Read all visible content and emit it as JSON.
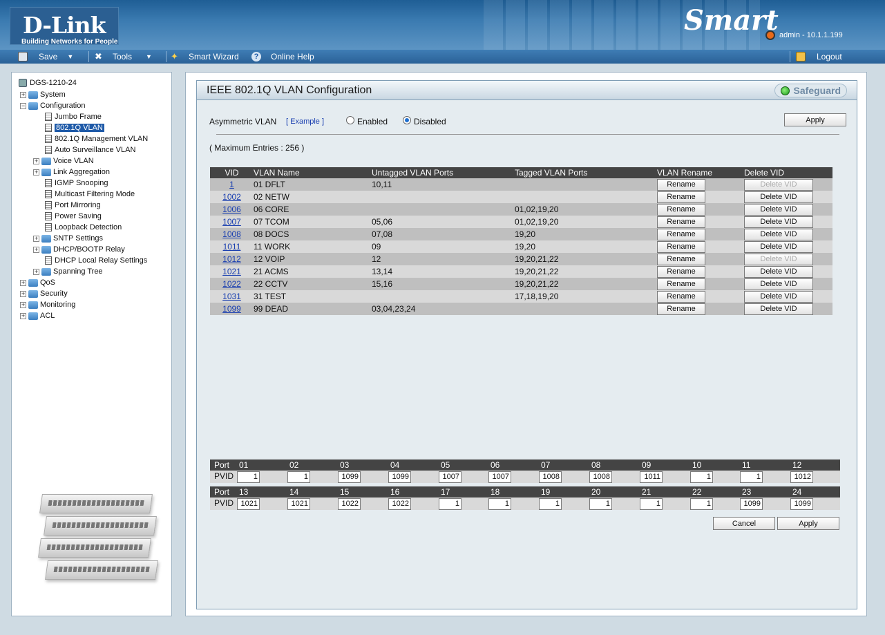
{
  "header": {
    "logo": "D-Link",
    "tagline": "Building Networks for People",
    "product": "Smart",
    "user": "admin - 10.1.1.199"
  },
  "menu": {
    "save": "Save",
    "tools": "Tools",
    "wizard": "Smart Wizard",
    "help": "Online Help",
    "logout": "Logout"
  },
  "tree": {
    "root": "DGS-1210-24",
    "system": "System",
    "configuration": "Configuration",
    "items": [
      "Jumbo Frame",
      "802.1Q VLAN",
      "802.1Q Management VLAN",
      "Auto Surveillance VLAN",
      "Voice VLAN",
      "Link Aggregation",
      "IGMP Snooping",
      "Multicast Filtering Mode",
      "Port Mirroring",
      "Power Saving",
      "Loopback Detection",
      "SNTP Settings",
      "DHCP/BOOTP Relay",
      "DHCP Local Relay Settings",
      "Spanning Tree"
    ],
    "qos": "QoS",
    "security": "Security",
    "monitoring": "Monitoring",
    "acl": "ACL"
  },
  "page": {
    "title": "IEEE 802.1Q VLAN Configuration",
    "safeguard": "Safeguard",
    "asym_label": "Asymmetric VLAN",
    "example": "[ Example ]",
    "enabled": "Enabled",
    "disabled": "Disabled",
    "apply": "Apply",
    "max_entries": "( Maximum Entries : 256 )",
    "cancel": "Cancel",
    "rename": "Rename",
    "delete": "Delete VID"
  },
  "table": {
    "headers": [
      "VID",
      "VLAN Name",
      "Untagged VLAN Ports",
      "Tagged VLAN Ports",
      "VLAN Rename",
      "Delete VID"
    ],
    "rows": [
      {
        "vid": "1",
        "name": "01 DFLT",
        "untagged": "10,11",
        "tagged": "",
        "delete_enabled": false
      },
      {
        "vid": "1002",
        "name": "02 NETW",
        "untagged": "",
        "tagged": "",
        "delete_enabled": true
      },
      {
        "vid": "1006",
        "name": "06 CORE",
        "untagged": "",
        "tagged": "01,02,19,20",
        "delete_enabled": true
      },
      {
        "vid": "1007",
        "name": "07 TCOM",
        "untagged": "05,06",
        "tagged": "01,02,19,20",
        "delete_enabled": true
      },
      {
        "vid": "1008",
        "name": "08 DOCS",
        "untagged": "07,08",
        "tagged": "19,20",
        "delete_enabled": true
      },
      {
        "vid": "1011",
        "name": "11 WORK",
        "untagged": "09",
        "tagged": "19,20",
        "delete_enabled": true
      },
      {
        "vid": "1012",
        "name": "12 VOIP",
        "untagged": "12",
        "tagged": "19,20,21,22",
        "delete_enabled": false
      },
      {
        "vid": "1021",
        "name": "21 ACMS",
        "untagged": "13,14",
        "tagged": "19,20,21,22",
        "delete_enabled": true
      },
      {
        "vid": "1022",
        "name": "22 CCTV",
        "untagged": "15,16",
        "tagged": "19,20,21,22",
        "delete_enabled": true
      },
      {
        "vid": "1031",
        "name": "31 TEST",
        "untagged": "",
        "tagged": "17,18,19,20",
        "delete_enabled": true
      },
      {
        "vid": "1099",
        "name": "99 DEAD",
        "untagged": "03,04,23,24",
        "tagged": "",
        "delete_enabled": true
      }
    ]
  },
  "pvid": {
    "port_label": "Port",
    "pvid_label": "PVID",
    "groups": [
      {
        "ports": [
          "01",
          "02",
          "03",
          "04",
          "05",
          "06",
          "07",
          "08",
          "09",
          "10",
          "11",
          "12"
        ],
        "values": [
          "1",
          "1",
          "1099",
          "1099",
          "1007",
          "1007",
          "1008",
          "1008",
          "1011",
          "1",
          "1",
          "1012"
        ]
      },
      {
        "ports": [
          "13",
          "14",
          "15",
          "16",
          "17",
          "18",
          "19",
          "20",
          "21",
          "22",
          "23",
          "24"
        ],
        "values": [
          "1021",
          "1021",
          "1022",
          "1022",
          "1",
          "1",
          "1",
          "1",
          "1",
          "1",
          "1099",
          "1099"
        ]
      }
    ]
  }
}
